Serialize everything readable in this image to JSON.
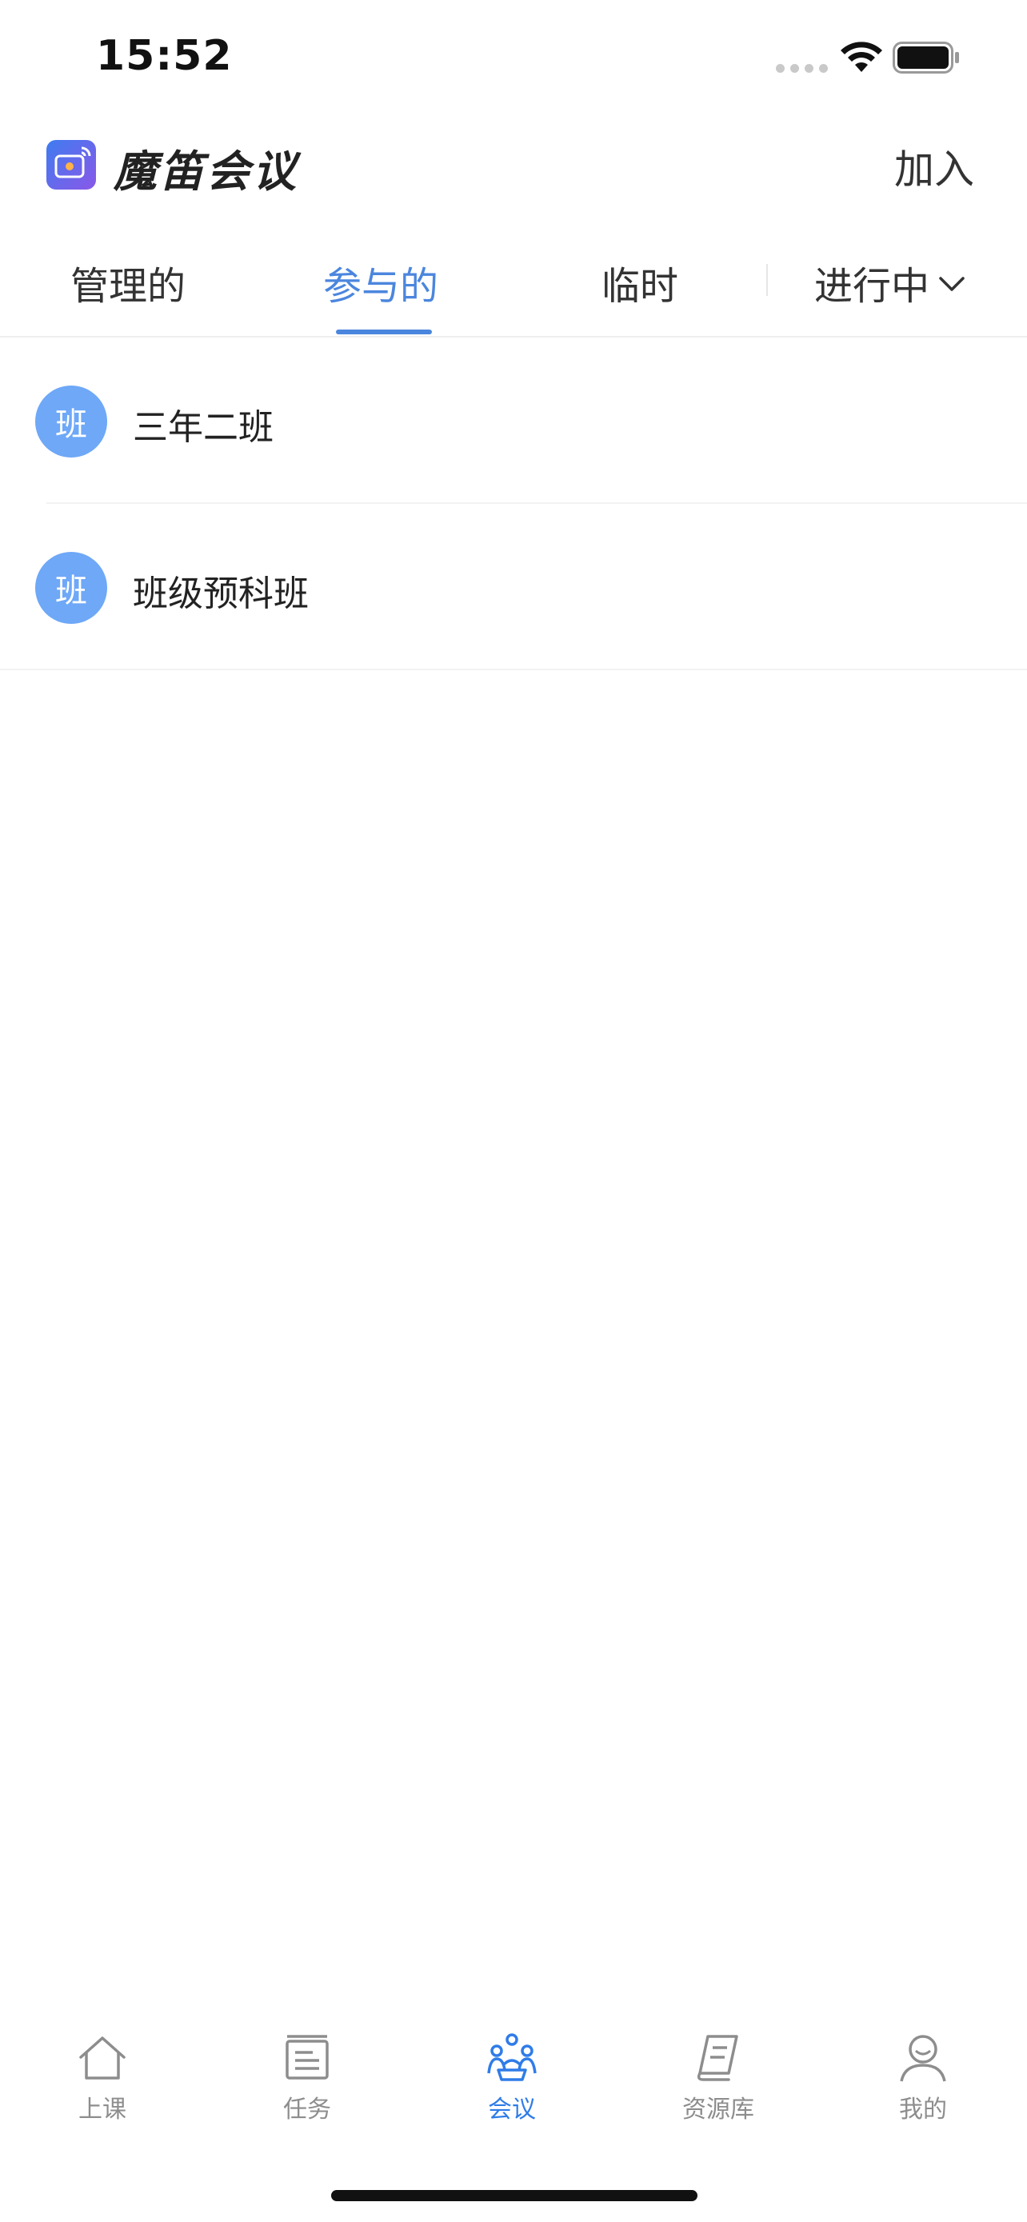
{
  "status_bar": {
    "time": "15:52"
  },
  "header": {
    "app_title": "魔笛会议",
    "join_label": "加入"
  },
  "tabs": [
    {
      "label": "管理的"
    },
    {
      "label": "参与的"
    },
    {
      "label": "临时"
    }
  ],
  "active_tab_index": 1,
  "filter": {
    "label": "进行中"
  },
  "list": [
    {
      "avatar_text": "班",
      "name": "三年二班"
    },
    {
      "avatar_text": "班",
      "name": "班级预科班"
    }
  ],
  "bottom_nav": [
    {
      "label": "上课",
      "icon": "home-icon"
    },
    {
      "label": "任务",
      "icon": "task-icon"
    },
    {
      "label": "会议",
      "icon": "meeting-icon"
    },
    {
      "label": "资源库",
      "icon": "book-icon"
    },
    {
      "label": "我的",
      "icon": "profile-icon"
    }
  ],
  "active_nav_index": 2,
  "colors": {
    "accent": "#4b86de",
    "avatar": "#6ea8f7",
    "nav_active": "#2f7ce8",
    "nav_inactive": "#8d8d8d"
  }
}
